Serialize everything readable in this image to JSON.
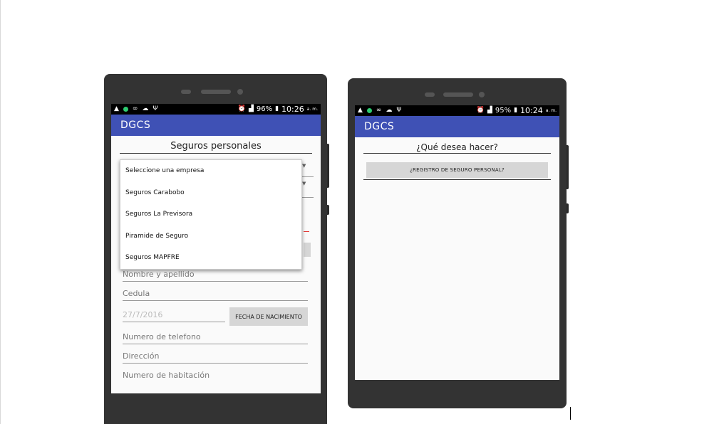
{
  "left_phone": {
    "status": {
      "time": "10:26",
      "ampm": "a. m.",
      "battery": "96%"
    },
    "app_title": "DGCS",
    "section_title": "Seguros personales",
    "dropdown_options": [
      "Seleccione una empresa",
      "Seguros Carabobo",
      "Seguros La Previsora",
      "Piramide de Seguro",
      "Seguros MAPFRE"
    ],
    "fields": {
      "name": "Nombre y apellido",
      "cedula": "Cedula",
      "date_value": "27/7/2016",
      "date_button": "FECHA DE NACIMIENTO",
      "phone": "Numero de telefono",
      "address": "Dirección",
      "room": "Numero de habitación"
    }
  },
  "right_phone": {
    "status": {
      "time": "10:24",
      "ampm": "a. m.",
      "battery": "95%"
    },
    "app_title": "DGCS",
    "question": "¿Qué desea hacer?",
    "register_button": "¿REGISTRO DE SEGURO PERSONAL?"
  }
}
